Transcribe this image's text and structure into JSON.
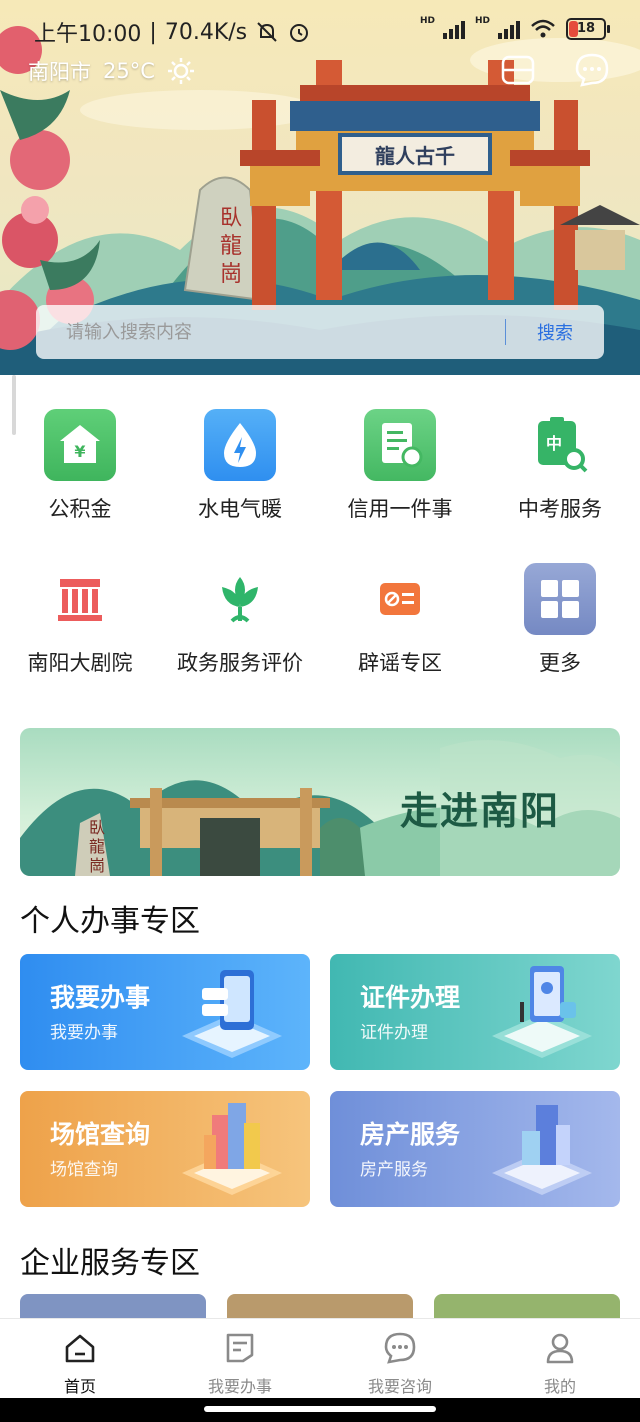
{
  "status_bar": {
    "time": "上午10:00",
    "separator": "|",
    "speed": "70.4K/s",
    "hd1": "HD",
    "hd2": "HD",
    "battery": "18"
  },
  "header": {
    "city": "南阳市",
    "temperature": "25°C",
    "weather_icon": "sun-icon",
    "scan_icon": "scan-icon",
    "message_icon": "chat-bubble-icon"
  },
  "hero_sign": {
    "gate_plaque": "龍人古千",
    "stone_text": "臥龍崗"
  },
  "search": {
    "placeholder": "请输入搜索内容",
    "button_label": "搜索"
  },
  "services": [
    {
      "label": "公积金",
      "icon": "housing-fund-icon"
    },
    {
      "label": "水电气暖",
      "icon": "utilities-drop-icon"
    },
    {
      "label": "信用一件事",
      "icon": "credit-document-icon"
    },
    {
      "label": "中考服务",
      "icon": "exam-search-icon"
    },
    {
      "label": "南阳大剧院",
      "icon": "theater-building-icon"
    },
    {
      "label": "政务服务评价",
      "icon": "lotus-icon"
    },
    {
      "label": "辟谣专区",
      "icon": "rumor-card-icon"
    },
    {
      "label": "更多",
      "icon": "more-grid-icon"
    }
  ],
  "banner": {
    "title": "走进南阳",
    "stone_text": "臥龍崗"
  },
  "personal": {
    "title": "个人办事专区",
    "cards": [
      {
        "title": "我要办事",
        "subtitle": "我要办事",
        "color_from": "#2f8df0",
        "color_to": "#5db4fb"
      },
      {
        "title": "证件办理",
        "subtitle": "证件办理",
        "color_from": "#41b8b2",
        "color_to": "#7fd6cf"
      },
      {
        "title": "场馆查询",
        "subtitle": "场馆查询",
        "color_from": "#eea24a",
        "color_to": "#f6c47c"
      },
      {
        "title": "房产服务",
        "subtitle": "房产服务",
        "color_from": "#6f8fd9",
        "color_to": "#a4b8ec"
      }
    ]
  },
  "enterprise": {
    "title": "企业服务专区",
    "tab_colors": [
      "#7f94c2",
      "#b99a6c",
      "#95b46d"
    ]
  },
  "bottom_nav": [
    {
      "label": "首页",
      "icon": "home-icon",
      "active": true
    },
    {
      "label": "我要办事",
      "icon": "task-document-icon",
      "active": false
    },
    {
      "label": "我要咨询",
      "icon": "consult-chat-icon",
      "active": false
    },
    {
      "label": "我的",
      "icon": "profile-icon",
      "active": false
    }
  ]
}
